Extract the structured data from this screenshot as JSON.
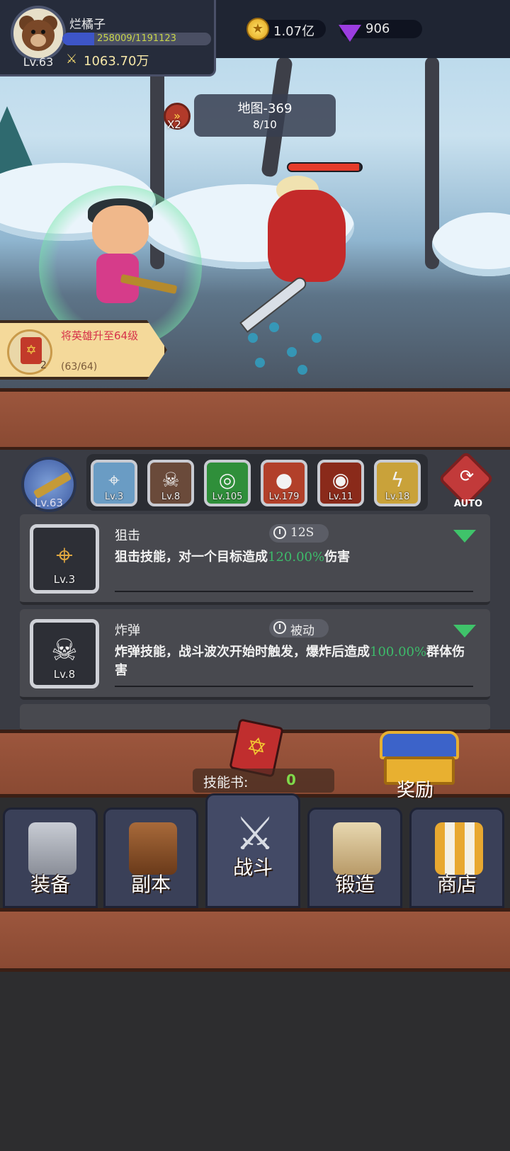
{
  "player": {
    "name": "烂橘子",
    "level": "Lv.63",
    "exp_text": "258009/1191123",
    "exp_progress": 0.2166,
    "power": "1063.70万"
  },
  "currencies": {
    "gold": "1.07亿",
    "gems": "906"
  },
  "battle": {
    "speed_label": "X2",
    "map_title": "地图-369",
    "wave": "8/10",
    "enemy_hp": 0.97
  },
  "quest": {
    "text": "将英雄升至64级",
    "progress": "(63/64)",
    "reward_count": "2"
  },
  "weapon": {
    "level": "Lv.63"
  },
  "skill_slots": [
    {
      "level": "Lv.3",
      "color": "#6a9cc4",
      "glyph": "⌖"
    },
    {
      "level": "Lv.8",
      "color": "#6a4a3a",
      "glyph": "☠"
    },
    {
      "level": "Lv.105",
      "color": "#2f8f3a",
      "glyph": "◎"
    },
    {
      "level": "Lv.179",
      "color": "#b2402a",
      "glyph": "●"
    },
    {
      "level": "Lv.11",
      "color": "#8a2a1a",
      "glyph": "◉"
    },
    {
      "level": "Lv.18",
      "color": "#c9a23a",
      "glyph": "ϟ"
    }
  ],
  "auto_label": "AUTO",
  "skills": [
    {
      "name": "狙击",
      "cooldown": "12S",
      "level": "Lv.3",
      "desc_before": "狙击技能，对一个目标造成",
      "desc_value": "120.00%",
      "desc_after": "伤害"
    },
    {
      "name": "炸弹",
      "cooldown": "被动",
      "level": "Lv.8",
      "desc_before": "炸弹技能，战斗波次开始时触发，爆炸后造成",
      "desc_value": "100.00%",
      "desc_after": "群体伤害"
    }
  ],
  "skill_book": {
    "label": "技能书:",
    "count": "0"
  },
  "reward_label": "奖励",
  "nav": [
    {
      "label": "装备",
      "icon": "helmet-icon"
    },
    {
      "label": "副本",
      "icon": "sword-shield-icon"
    },
    {
      "label": "战斗",
      "icon": "crossed-swords-icon",
      "active": true
    },
    {
      "label": "锻造",
      "icon": "hammer-scroll-icon"
    },
    {
      "label": "商店",
      "icon": "shop-icon"
    }
  ],
  "colors": {
    "highlight": "#3dbb6a",
    "quest_text": "#d6324a",
    "wood": "#9c563d"
  }
}
